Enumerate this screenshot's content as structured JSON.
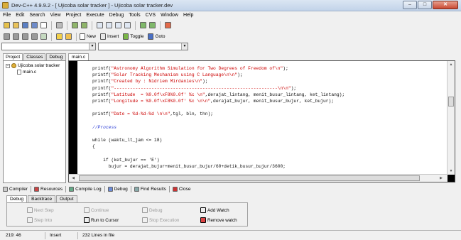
{
  "window": {
    "title": "Dev-C++ 4.9.9.2  - [ Ujicoba solar tracker ] - Ujicoba solar tracker.dev"
  },
  "menu": [
    "File",
    "Edit",
    "Search",
    "View",
    "Project",
    "Execute",
    "Debug",
    "Tools",
    "CVS",
    "Window",
    "Help"
  ],
  "toolbar2": {
    "new_label": "New",
    "insert_label": "Insert",
    "toggle_label": "Toggle",
    "goto_label": "Goto"
  },
  "left_panel": {
    "tabs": [
      "Project",
      "Classes",
      "Debug"
    ],
    "tree": {
      "project": "Ujicoba solar tracker",
      "file": "main.c"
    }
  },
  "editor": {
    "tab": "main.c",
    "lines": [
      {
        "text": "printf(\"Astronomy Algorithm Simulation for Two Degrees of Freedom of\\n\");",
        "kind": "call"
      },
      {
        "text": "printf(\"Solar Tracking Mechanism using C Language\\n\\n\");",
        "kind": "call"
      },
      {
        "text": "printf(\"Created by : Nidriem Mirdanies\\n\");",
        "kind": "call"
      },
      {
        "text": "printf(\"-------------------------------------------------------------\\n\\n\");",
        "kind": "call"
      },
      {
        "text": "printf(\"Latitude  = %0.0f\\xF8%0.0f' %c \\n\",derajat_lintang, menit_busur_lintang, ket_lintang);",
        "kind": "call"
      },
      {
        "text": "printf(\"Longitude = %0.0f\\xF8%0.0f' %c \\n\\n\",derajat_bujur, menit_busur_bujur, ket_bujur);",
        "kind": "call"
      },
      {
        "text": "",
        "kind": "blank"
      },
      {
        "text": "printf(\"Date = %d-%d-%d \\n\\n\",tgl, bln, thn);",
        "kind": "call"
      },
      {
        "text": "",
        "kind": "blank"
      },
      {
        "text": "//Process",
        "kind": "comment"
      },
      {
        "text": "",
        "kind": "blank"
      },
      {
        "text": "while (waktu_lt_jam <= 18)",
        "kind": "plain"
      },
      {
        "text": "{",
        "kind": "plain"
      },
      {
        "text": "",
        "kind": "blank"
      },
      {
        "text": "    if (ket_bujur == 'E')",
        "kind": "plain"
      },
      {
        "text": "      bujur = derajat_bujur+menit_busur_bujur/60+detik_busur_bujur/3600;",
        "kind": "plain"
      }
    ]
  },
  "bottom_tabs": [
    "Compiler",
    "Resources",
    "Compile Log",
    "Debug",
    "Find Results",
    "Close"
  ],
  "debug_tabs": [
    "Debug",
    "Backtrace",
    "Output"
  ],
  "debug_buttons": {
    "next_step": "Next Step",
    "step_into": "Step Into",
    "continue": "Continue",
    "run_to_cursor": "Run to Cursor",
    "debug": "Debug",
    "stop_execution": "Stop Execution",
    "add_watch": "Add Watch",
    "remove_watch": "Remove watch"
  },
  "status": {
    "position": "219: 46",
    "mode": "Insert",
    "info": "232 Lines in file"
  },
  "colors": {
    "call": "#cc0000",
    "comment": "#2e3fd6",
    "plain": "#111111",
    "editor_frame": "#000000",
    "titlebar": "#c9d8ec"
  }
}
